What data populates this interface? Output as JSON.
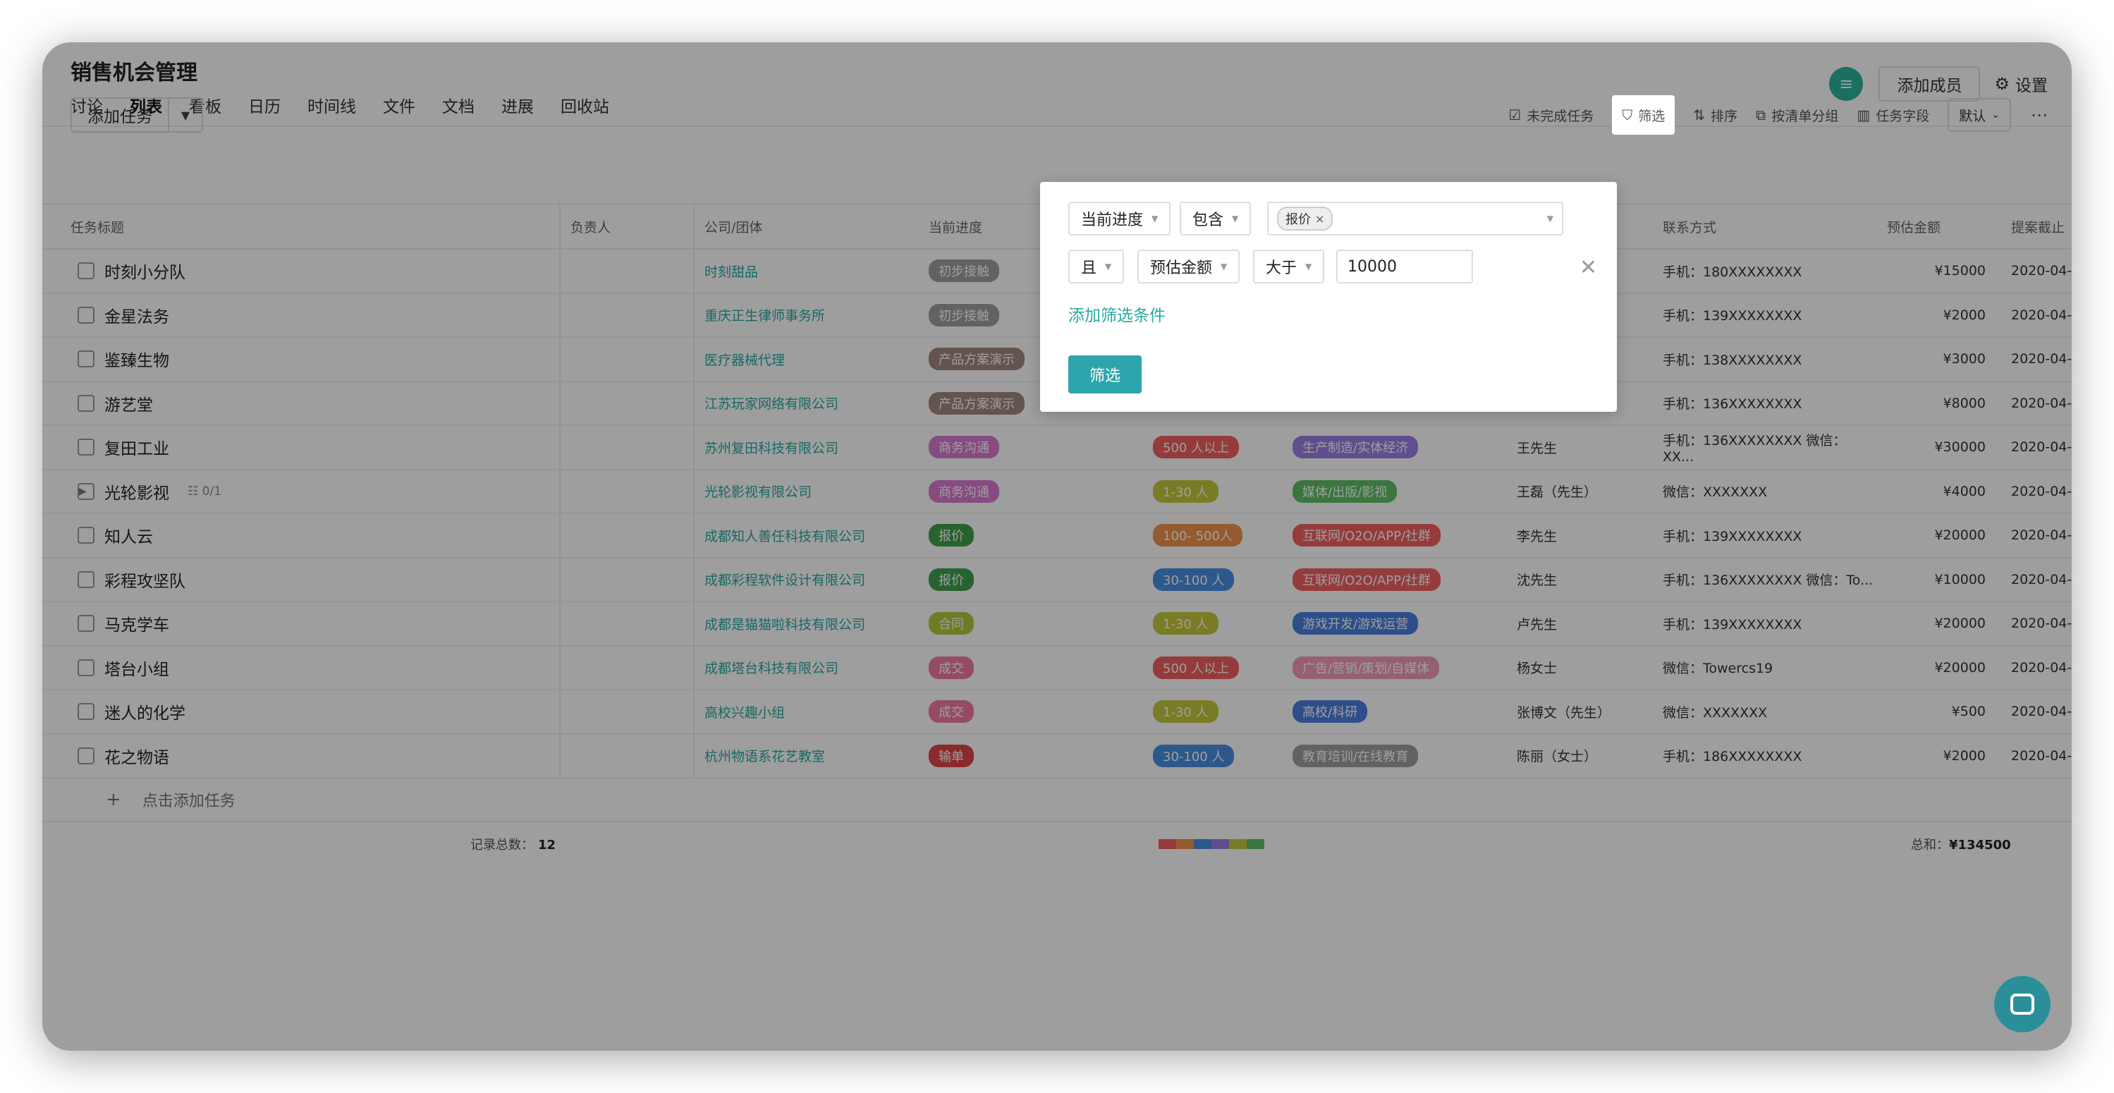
{
  "project": {
    "title": "销售机会管理"
  },
  "nav": [
    "讨论",
    "列表",
    "看板",
    "日历",
    "时间线",
    "文件",
    "文档",
    "进展",
    "回收站"
  ],
  "header": {
    "avatar_glyph": "≡",
    "add_member": "添加成员",
    "settings": "设置"
  },
  "toolbar": {
    "add_task": "添加任务",
    "incomplete": "未完成任务",
    "filter": "筛选",
    "sort": "排序",
    "group": "按清单分组",
    "fields": "任务字段",
    "default": "默认"
  },
  "columns": [
    "任务标题",
    "负责人",
    "公司/团体",
    "当前进度",
    "",
    "",
    "",
    "联系方式",
    "预估金额",
    "提案截止"
  ],
  "rows": [
    {
      "name": "时刻小分队",
      "company": "时刻甜品",
      "stage": "初步接触",
      "stage_color": "#9e9e9e",
      "size": "",
      "size_color": "",
      "industry": "",
      "industry_color": "",
      "contact_person": "",
      "contact": "手机：180XXXXXXXX",
      "amount": "¥15000",
      "date": "2020-04-2"
    },
    {
      "name": "金星法务",
      "company": "重庆正生律师事务所",
      "stage": "初步接触",
      "stage_color": "#9e9e9e",
      "size": "",
      "size_color": "",
      "industry": "",
      "industry_color": "",
      "contact_person": "",
      "contact": "手机：139XXXXXXXX",
      "amount": "¥2000",
      "date": "2020-04-2"
    },
    {
      "name": "鉴臻生物",
      "company": "医疗器械代理",
      "stage": "产品方案演示",
      "stage_color": "#a1887f",
      "size": "",
      "size_color": "",
      "industry": "",
      "industry_color": "",
      "contact_person": "",
      "contact": "手机：138XXXXXXXX",
      "amount": "¥3000",
      "date": "2020-04-2"
    },
    {
      "name": "游艺堂",
      "company": "江苏玩家网络有限公司",
      "stage": "产品方案演示",
      "stage_color": "#a1887f",
      "size": "",
      "size_color": "",
      "industry": "",
      "industry_color": "",
      "contact_person": "",
      "contact": "手机：136XXXXXXXX",
      "amount": "¥8000",
      "date": "2020-04-"
    },
    {
      "name": "复田工业",
      "company": "苏州复田科技有限公司",
      "stage": "商务沟通",
      "stage_color": "#d97ad0",
      "size": "500 人以上",
      "size_color": "#f06060",
      "industry": "生产制造/实体经济",
      "industry_color": "#9b7ee6",
      "contact_person": "王先生",
      "contact": "手机：136XXXXXXXX 微信：XX...",
      "amount": "¥30000",
      "date": "2020-04-"
    },
    {
      "name": "光轮影视",
      "subtask": "0/1",
      "company": "光轮影视有限公司",
      "stage": "商务沟通",
      "stage_color": "#d97ad0",
      "size": "1-30 人",
      "size_color": "#c4c93a",
      "industry": "媒体/出版/影视",
      "industry_color": "#5fbf66",
      "contact_person": "王磊（先生）",
      "contact": "微信：XXXXXXX",
      "amount": "¥4000",
      "date": "2020-04-"
    },
    {
      "name": "知人云",
      "company": "成都知人善任科技有限公司",
      "stage": "报价",
      "stage_color": "#3f9e4c",
      "size": "100- 500人",
      "size_color": "#f0924a",
      "industry": "互联网/O2O/APP/社群",
      "industry_color": "#f06060",
      "contact_person": "李先生",
      "contact": "手机：139XXXXXXXX",
      "amount": "¥20000",
      "date": "2020-04-2"
    },
    {
      "name": "彩程攻坚队",
      "company": "成都彩程软件设计有限公司",
      "stage": "报价",
      "stage_color": "#3f9e4c",
      "size": "30-100 人",
      "size_color": "#4a8fe0",
      "industry": "互联网/O2O/APP/社群",
      "industry_color": "#f06060",
      "contact_person": "沈先生",
      "contact": "手机：136XXXXXXXX 微信：To...",
      "amount": "¥10000",
      "date": "2020-04-2"
    },
    {
      "name": "马克学车",
      "company": "成都是猫猫啦科技有限公司",
      "stage": "合同",
      "stage_color": "#b5c73a",
      "size": "1-30 人",
      "size_color": "#c4c93a",
      "industry": "游戏开发/游戏运营",
      "industry_color": "#4a7fe0",
      "contact_person": "卢先生",
      "contact": "手机：139XXXXXXXX",
      "amount": "¥20000",
      "date": "2020-04-2"
    },
    {
      "name": "塔台小组",
      "company": "成都塔台科技有限公司",
      "stage": "成交",
      "stage_color": "#f07aa0",
      "size": "500 人以上",
      "size_color": "#f06060",
      "industry": "广告/营销/策划/自媒体",
      "industry_color": "#f29ab8",
      "contact_person": "杨女士",
      "contact": "微信：Towercs19",
      "amount": "¥20000",
      "date": "2020-04-2"
    },
    {
      "name": "迷人的化学",
      "company": "高校兴趣小组",
      "stage": "成交",
      "stage_color": "#f07aa0",
      "size": "1-30 人",
      "size_color": "#c4c93a",
      "industry": "高校/科研",
      "industry_color": "#4a7fe0",
      "contact_person": "张博文（先生）",
      "contact": "微信：XXXXXXX",
      "amount": "¥500",
      "date": "2020-04-2"
    },
    {
      "name": "花之物语",
      "company": "杭州物语系花艺教室",
      "stage": "输单",
      "stage_color": "#e04545",
      "size": "30-100 人",
      "size_color": "#4a8fe0",
      "industry": "教育培训/在线教育",
      "industry_color": "#9e9e9e",
      "contact_person": "陈丽（女士）",
      "contact": "手机：186XXXXXXXX",
      "amount": "¥2000",
      "date": "2020-04-2"
    }
  ],
  "add_row": "点击添加任务",
  "summary": {
    "count_label": "记录总数：",
    "count": "12",
    "total_label": "总和：",
    "total": "¥134500"
  },
  "summary_colors": [
    "#f06060",
    "#f0924a",
    "#4a8fe0",
    "#9b7ee6",
    "#c4c93a",
    "#5fbf66"
  ],
  "filter": {
    "row1": {
      "field": "当前进度",
      "op": "包含",
      "chip": "报价"
    },
    "row2": {
      "logic": "且",
      "field": "预估金额",
      "op": "大于",
      "value": "10000"
    },
    "add_condition": "添加筛选条件",
    "submit": "筛选",
    "close_glyph": "✕"
  }
}
